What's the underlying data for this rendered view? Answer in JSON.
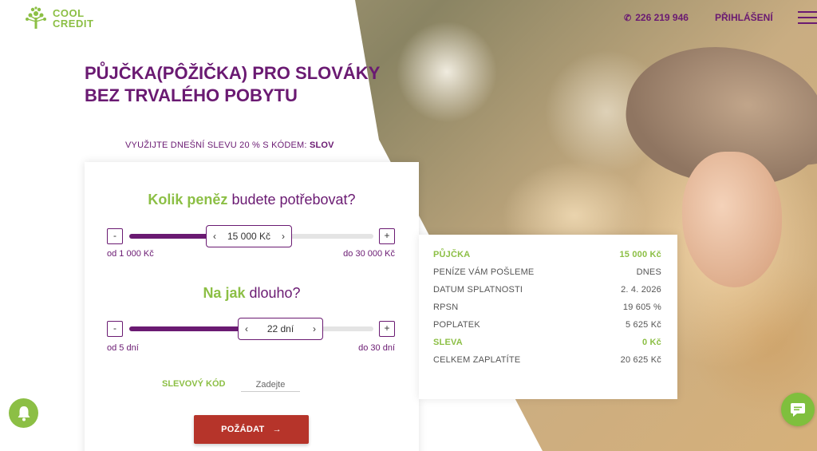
{
  "header": {
    "logo_line1": "COOL",
    "logo_line2": "CREDIT",
    "phone": "226 219 946",
    "login_label": "PŘIHLÁŠENÍ",
    "menu_icon": "hamburger-icon"
  },
  "hero": {
    "title_part1": "PŮJČKA(PÔŽIČKA) PRO ",
    "title_bold": "SLOVÁKY",
    "title_line2": "BEZ TRVALÉHO POBYTU",
    "promo_text": "VYUŽIJTE DNEŠNÍ SLEVU 20 % S KÓDEM: ",
    "promo_code": "SLOV"
  },
  "calculator": {
    "amount": {
      "heading_bold": "Kolik peněz",
      "heading_rest": " budete potřebovat?",
      "minus": "-",
      "plus": "+",
      "value": "15 000 Kč",
      "min_label": "od 1 000 Kč",
      "max_label": "do 30 000 Kč",
      "min": 1000,
      "max": 30000,
      "current": 15000
    },
    "duration": {
      "heading_bold": "Na jak",
      "heading_rest": " dlouho?",
      "minus": "-",
      "plus": "+",
      "value": "22 dní",
      "min_label": "od 5 dní",
      "max_label": "do 30 dní",
      "min": 5,
      "max": 30,
      "current": 22
    },
    "discount_label": "SLEVOVÝ KÓD",
    "discount_placeholder": "Zadejte",
    "submit_label": "POŽÁDAT",
    "submit_arrow": "→"
  },
  "summary": {
    "rows": [
      {
        "label": "PŮJČKA",
        "value": "15 000 Kč",
        "highlight": true
      },
      {
        "label": "PENÍZE VÁM POŠLEME",
        "value": "DNES",
        "highlight": false
      },
      {
        "label": "DATUM SPLATNOSTI",
        "value": "2. 4. 2026",
        "highlight": false
      },
      {
        "label": "RPSN",
        "value": "19 605 %",
        "highlight": false
      },
      {
        "label": "POPLATEK",
        "value": "5 625 Kč",
        "highlight": false
      },
      {
        "label": "SLEVA",
        "value": "0 Kč",
        "highlight": true
      },
      {
        "label": "CELKEM ZAPLATÍTE",
        "value": "20 625 Kč",
        "highlight": false
      }
    ]
  },
  "floating": {
    "bell_icon": "bell-icon",
    "chat_icon": "chat-icon"
  },
  "colors": {
    "brand_purple": "#6a1a72",
    "brand_green": "#8cbf45",
    "cta_red": "#b6342a"
  }
}
